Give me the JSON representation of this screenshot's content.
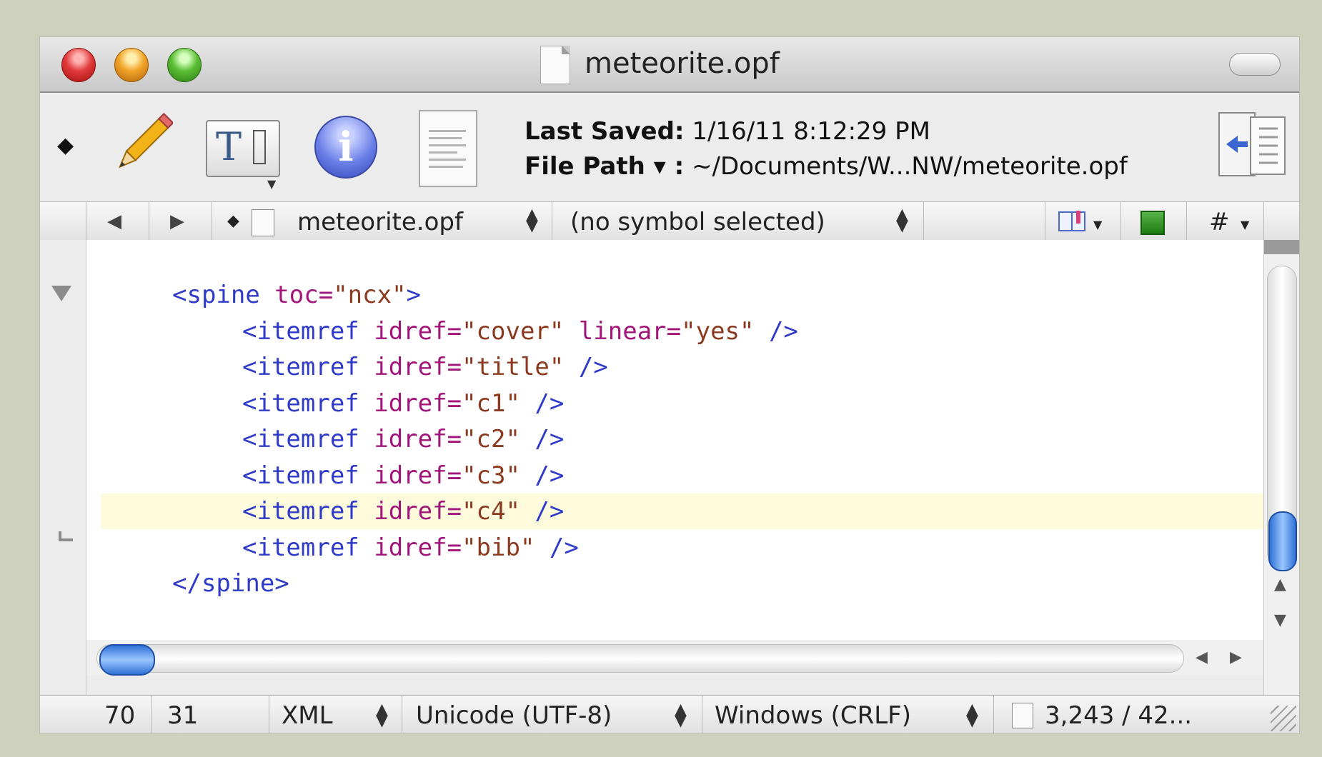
{
  "window": {
    "title": "meteorite.opf"
  },
  "toolbar": {
    "last_saved_label": "Last Saved:",
    "last_saved_value": "1/16/11 8:12:29 PM",
    "file_path_label": "File Path ▾ :",
    "file_path_value": "~/Documents/W...NW/meteorite.opf",
    "info_glyph": "i",
    "marker_glyph": "◆",
    "icons": [
      "pencil-icon",
      "text-options-icon",
      "info-icon",
      "document-icon",
      "sidebar-panel-icon"
    ]
  },
  "navbar": {
    "back": "◀",
    "forward": "▶",
    "marker": "◆",
    "file_name": "meteorite.opf",
    "symbol": "(no symbol selected)",
    "hash": "#"
  },
  "editor": {
    "lines": [
      {
        "indent": "    ",
        "parts": [
          [
            "tag",
            "<spine "
          ],
          [
            "attr",
            "toc="
          ],
          [
            "val",
            "\"ncx\""
          ],
          [
            "tag",
            ">"
          ]
        ]
      },
      {
        "indent": "        ",
        "parts": [
          [
            "tag",
            "<itemref "
          ],
          [
            "attr",
            "idref="
          ],
          [
            "val",
            "\"cover\" "
          ],
          [
            "attr",
            "linear="
          ],
          [
            "val",
            "\"yes\" "
          ],
          [
            "tag",
            "/>"
          ]
        ]
      },
      {
        "indent": "        ",
        "parts": [
          [
            "tag",
            "<itemref "
          ],
          [
            "attr",
            "idref="
          ],
          [
            "val",
            "\"title\" "
          ],
          [
            "tag",
            "/>"
          ]
        ]
      },
      {
        "indent": "        ",
        "parts": [
          [
            "tag",
            "<itemref "
          ],
          [
            "attr",
            "idref="
          ],
          [
            "val",
            "\"c1\" "
          ],
          [
            "tag",
            "/>"
          ]
        ]
      },
      {
        "indent": "        ",
        "parts": [
          [
            "tag",
            "<itemref "
          ],
          [
            "attr",
            "idref="
          ],
          [
            "val",
            "\"c2\" "
          ],
          [
            "tag",
            "/>"
          ]
        ]
      },
      {
        "indent": "        ",
        "parts": [
          [
            "tag",
            "<itemref "
          ],
          [
            "attr",
            "idref="
          ],
          [
            "val",
            "\"c3\" "
          ],
          [
            "tag",
            "/>"
          ]
        ]
      },
      {
        "indent": "        ",
        "parts": [
          [
            "tag",
            "<itemref "
          ],
          [
            "attr",
            "idref="
          ],
          [
            "val",
            "\"c4\" "
          ],
          [
            "tag",
            "/>"
          ]
        ]
      },
      {
        "indent": "        ",
        "parts": [
          [
            "tag",
            "<itemref "
          ],
          [
            "attr",
            "idref="
          ],
          [
            "val",
            "\"bib\" "
          ],
          [
            "tag",
            "/>"
          ]
        ]
      },
      {
        "indent": "    ",
        "parts": [
          [
            "tag",
            "</spine>"
          ]
        ]
      }
    ],
    "highlighted_line": 7,
    "colors": {
      "tag": "#2f3bc8",
      "attr": "#a2157a",
      "value": "#8b3a20",
      "highlight": "#fdfbdc"
    }
  },
  "statusbar": {
    "line": "70",
    "column": "31",
    "language": "XML",
    "encoding": "Unicode (UTF-8)",
    "line_endings": "Windows (CRLF)",
    "size": "3,243 / 42..."
  }
}
